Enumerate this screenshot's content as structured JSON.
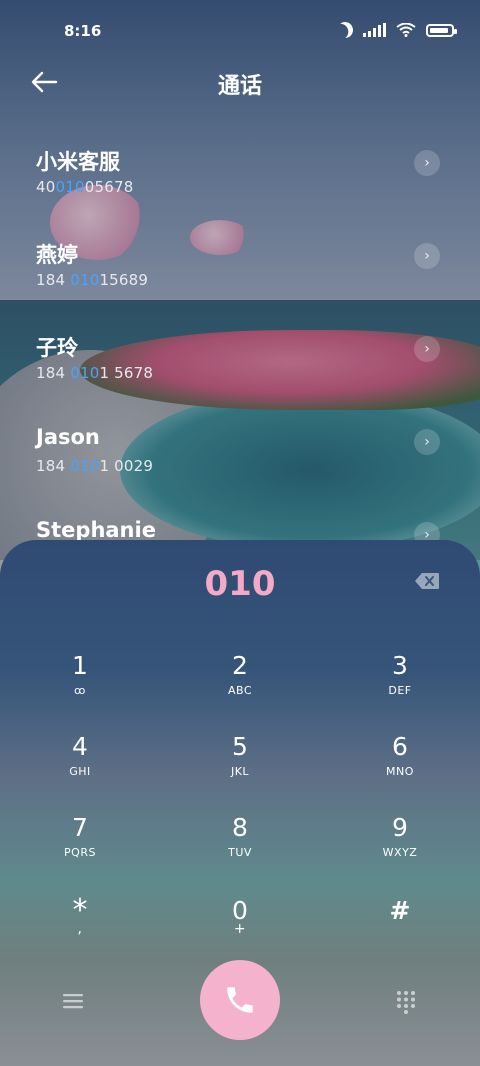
{
  "status": {
    "time": "8:16"
  },
  "header": {
    "title": "通话"
  },
  "contacts": [
    {
      "name": "小米客服",
      "number_pre": "40",
      "number_hl": "010",
      "number_post": "05678"
    },
    {
      "name": "燕婷",
      "number_pre": "184 ",
      "number_hl": "010",
      "number_post": "15689"
    },
    {
      "name": "子玲",
      "number_pre": "184 ",
      "number_hl": "010",
      "number_post": "1 5678"
    },
    {
      "name": "Jason",
      "number_pre": "184 ",
      "number_hl": "010",
      "number_post": "1 0029"
    },
    {
      "name": "Stephanie",
      "number_pre": "",
      "number_hl": "",
      "number_post": ""
    }
  ],
  "dialer": {
    "digits": "010",
    "keys": [
      {
        "num": "1",
        "letters": "ꝏ"
      },
      {
        "num": "2",
        "letters": "ABC"
      },
      {
        "num": "3",
        "letters": "DEF"
      },
      {
        "num": "4",
        "letters": "GHI"
      },
      {
        "num": "5",
        "letters": "JKL"
      },
      {
        "num": "6",
        "letters": "MNO"
      },
      {
        "num": "7",
        "letters": "PQRS"
      },
      {
        "num": "8",
        "letters": "TUV"
      },
      {
        "num": "9",
        "letters": "WXYZ"
      },
      {
        "num": "*",
        "letters": ","
      },
      {
        "num": "0",
        "letters": "+"
      },
      {
        "num": "#",
        "letters": ""
      }
    ]
  },
  "colors": {
    "accent_pink": "#f4a9c6",
    "highlight_blue": "#4aa2ff",
    "call_button": "#f4b2cc"
  }
}
